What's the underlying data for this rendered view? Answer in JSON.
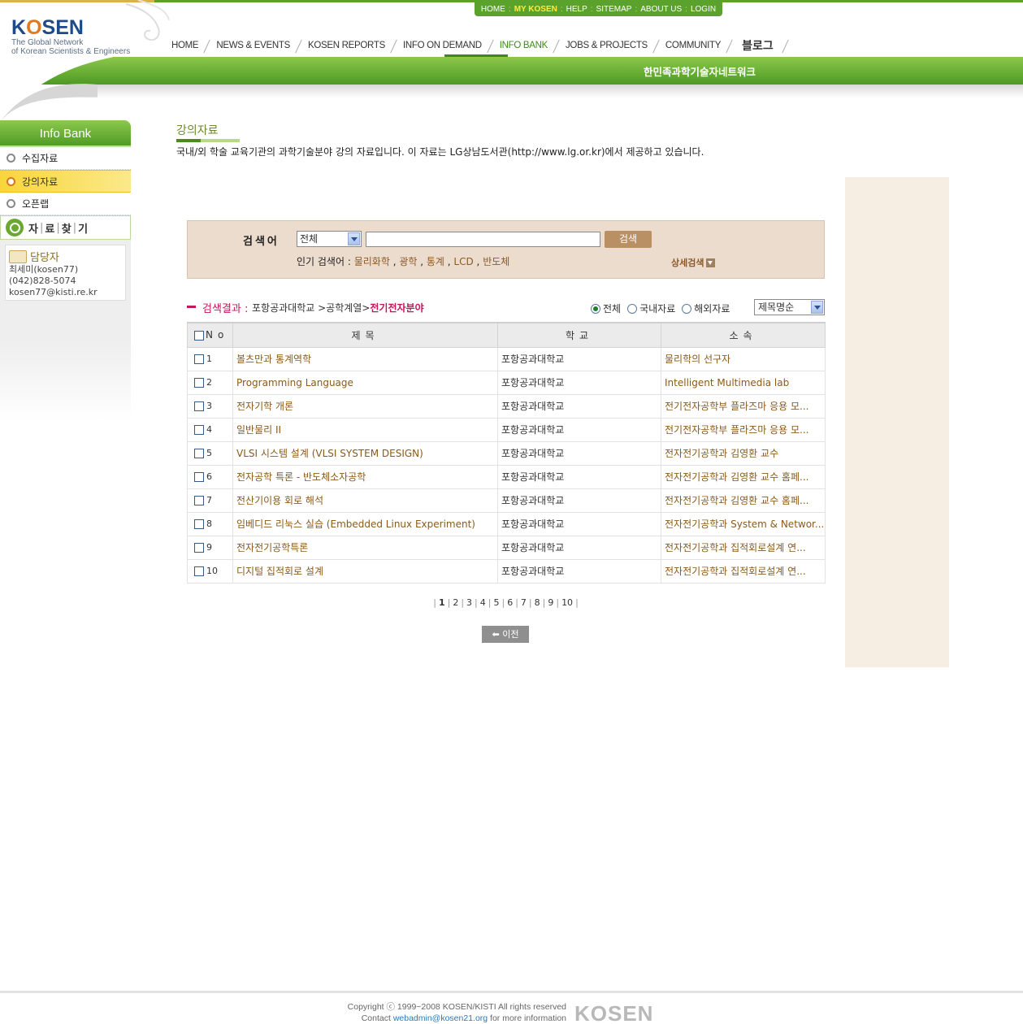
{
  "header": {
    "logo_word": "KOSEN",
    "logo_tag1": "The Global Network",
    "logo_tag2": "of Korean Scientists & Engineers",
    "util_links": [
      "HOME",
      "MY KOSEN",
      "HELP",
      "SITEMAP",
      "ABOUT US",
      "LOGIN"
    ],
    "nav": [
      "HOME",
      "NEWS & EVENTS",
      "KOSEN REPORTS",
      "INFO ON DEMAND",
      "INFO BANK",
      "JOBS & PROJECTS",
      "COMMUNITY"
    ],
    "nav_active": "INFO BANK",
    "blog": "블로그",
    "band_text": "한민족과학기술자네트워크"
  },
  "sidebar": {
    "title": "Info Bank",
    "items": [
      {
        "label": "수집자료",
        "active": false
      },
      {
        "label": "강의자료",
        "active": true
      },
      {
        "label": "오픈랩",
        "active": false
      }
    ],
    "search_parts": [
      "자",
      "료",
      "찾",
      "기"
    ],
    "contact": {
      "title": "담당자",
      "name": "최세미(kosen77)",
      "phone": "(042)828-5074",
      "email": "kosen77@kisti.re.kr"
    }
  },
  "page": {
    "title": "강의자료",
    "description": "국내/외 학술 교육기관의 과학기술분야 강의 자료입니다. 이 자료는 LG상남도서관(http://www.lg.or.kr)에서 제공하고 있습니다."
  },
  "search": {
    "label": "검색어",
    "select_value": "전체",
    "input_value": "",
    "button": "검색",
    "popular_label": "인기 검색어 :",
    "popular": [
      "물리화학",
      "광학",
      "통계",
      "LCD",
      "반도체"
    ],
    "advanced": "상세검색"
  },
  "results": {
    "label": "검색결과 :",
    "path": [
      "포항공과대학교",
      ">공학계열>"
    ],
    "path_current": "전기전자분야",
    "filters": [
      {
        "label": "전체",
        "selected": true
      },
      {
        "label": "국내자료",
        "selected": false
      },
      {
        "label": "해외자료",
        "selected": false
      }
    ],
    "sort_value": "제목명순",
    "columns": {
      "no": "No",
      "title": "제목",
      "school": "학교",
      "dept": "소속"
    },
    "rows": [
      {
        "no": "1",
        "title": "볼츠만과 통계역학",
        "school": "포항공과대학교",
        "dept": "물리학의 선구자"
      },
      {
        "no": "2",
        "title": "Programming Language",
        "school": "포항공과대학교",
        "dept": "Intelligent Multimedia lab"
      },
      {
        "no": "3",
        "title": "전자기학 개론",
        "school": "포항공과대학교",
        "dept": "전기전자공학부 플라즈마 응용 모..."
      },
      {
        "no": "4",
        "title": "일반물리 II",
        "school": "포항공과대학교",
        "dept": "전기전자공학부 플라즈마 응용 모..."
      },
      {
        "no": "5",
        "title": "VLSI 시스템 설계 (VLSI SYSTEM DESIGN)",
        "school": "포항공과대학교",
        "dept": "전자전기공학과 김영환 교수"
      },
      {
        "no": "6",
        "title": "전자공학 특론 - 반도체소자공학",
        "school": "포항공과대학교",
        "dept": "전자전기공학과 김영환 교수 홈페..."
      },
      {
        "no": "7",
        "title": "전산기이용 회로 해석",
        "school": "포항공과대학교",
        "dept": "전자전기공학과 김영환 교수 홈페..."
      },
      {
        "no": "8",
        "title": "임베디드 리눅스 실습 (Embedded Linux Experiment)",
        "school": "포항공과대학교",
        "dept": "전자전기공학과 System & Networ..."
      },
      {
        "no": "9",
        "title": "전자전기공학특론",
        "school": "포항공과대학교",
        "dept": "전자전기공학과 집적회로설계 연..."
      },
      {
        "no": "10",
        "title": "디지털 집적회로 설계",
        "school": "포항공과대학교",
        "dept": "전자전기공학과 집적회로설계 연..."
      }
    ],
    "pages": [
      "1",
      "2",
      "3",
      "4",
      "5",
      "6",
      "7",
      "8",
      "9",
      "10"
    ],
    "current_page": "1",
    "prev": "이전"
  },
  "footer": {
    "copyright": "Copyright ⓒ 1999~2008  KOSEN/KISTI All rights reserved",
    "contact_pre": "Contact",
    "contact_mail": "webadmin@kosen21.org",
    "contact_post": "for more information",
    "logo": "KOSEN"
  },
  "colors": {
    "brand_green": "#5ba22c",
    "accent_pink": "#c2185b",
    "search_bg": "#ecdccd",
    "right_panel_bg": "#f6ede3"
  }
}
